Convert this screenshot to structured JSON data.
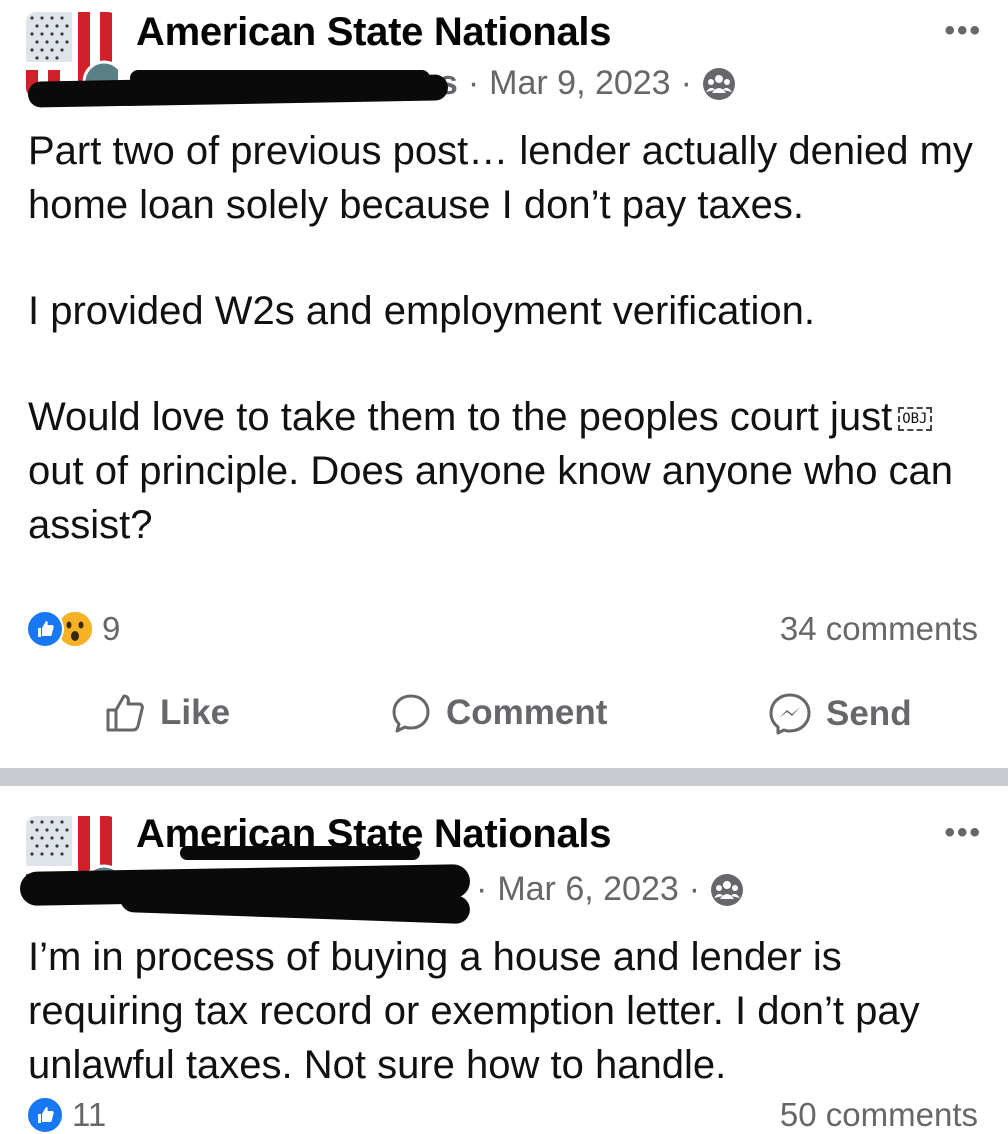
{
  "posts": [
    {
      "group_name": "American State Nationals",
      "author_visible_fragment": "es",
      "separator": "·",
      "date": "Mar 9, 2023",
      "privacy_icon": "group-icon",
      "more_label": "•••",
      "paragraphs": [
        "Part two of previous post… lender actually denied my home loan solely because I don’t pay taxes.",
        "I provided W2s and employment verification.",
        "Would love to take them to the peoples court just",
        "out of principle. Does anyone know anyone who can assist?"
      ],
      "obj_placeholder": "OBJ",
      "reaction_count": "9",
      "comment_count": "34 comments",
      "actions": {
        "like": "Like",
        "comment": "Comment",
        "send": "Send"
      }
    },
    {
      "group_name": "American State Nationals",
      "separator": "·",
      "date": "Mar 6, 2023",
      "privacy_icon": "group-icon",
      "more_label": "•••",
      "paragraphs": [
        "I’m in process of buying a house and lender is requiring tax record or exemption letter.  I don’t pay unlawful taxes.  Not sure how to handle."
      ],
      "reaction_count": "11",
      "comment_count": "50 comments"
    }
  ],
  "colors": {
    "like_blue": "#1877f2",
    "meta_gray": "#65676b",
    "divider": "#c9ccd1"
  }
}
